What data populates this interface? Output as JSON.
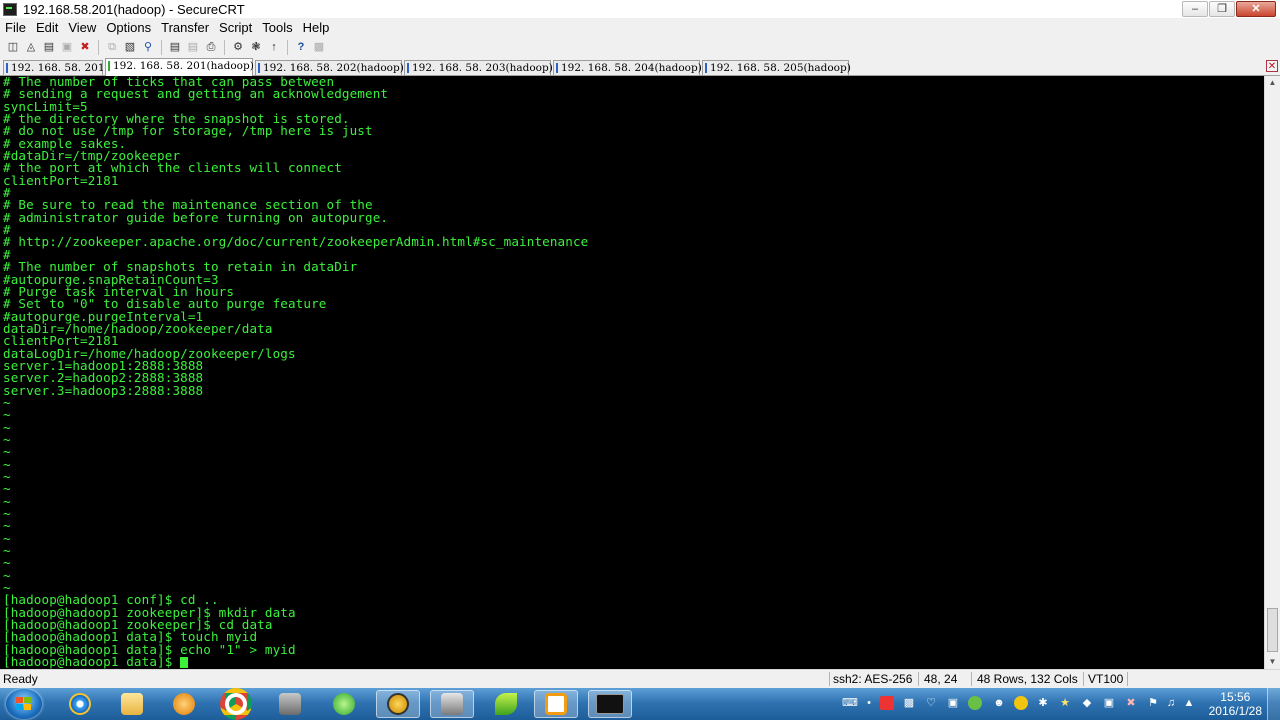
{
  "window": {
    "title": "192.168.58.201(hadoop) - SecureCRT"
  },
  "menu": [
    "File",
    "Edit",
    "View",
    "Options",
    "Transfer",
    "Script",
    "Tools",
    "Help"
  ],
  "toolbar": {
    "icons": [
      "connect-icon",
      "quick-connect-icon",
      "connect-in-tab-icon",
      "reconnect-icon",
      "disconnect-icon",
      "copy-icon",
      "paste-icon",
      "find-icon",
      "print-setup-icon",
      "print-selection-icon",
      "print-icon",
      "session-options-icon",
      "global-options-icon",
      "keymap-icon",
      "help-icon",
      "sftp-icon"
    ]
  },
  "tabs": [
    {
      "label": "192. 168. 58. 201",
      "active": false
    },
    {
      "label": "192. 168. 58. 201(hadoop)",
      "active": true
    },
    {
      "label": "192. 168. 58. 202(hadoop)",
      "active": false
    },
    {
      "label": "192. 168. 58. 203(hadoop)",
      "active": false
    },
    {
      "label": "192. 168. 58. 204(hadoop)",
      "active": false
    },
    {
      "label": "192. 168. 58. 205(hadoop)",
      "active": false
    }
  ],
  "terminal": {
    "lines": [
      "# The number of ticks that can pass between",
      "# sending a request and getting an acknowledgement",
      "syncLimit=5",
      "# the directory where the snapshot is stored.",
      "# do not use /tmp for storage, /tmp here is just",
      "# example sakes.",
      "#dataDir=/tmp/zookeeper",
      "# the port at which the clients will connect",
      "clientPort=2181",
      "#",
      "# Be sure to read the maintenance section of the",
      "# administrator guide before turning on autopurge.",
      "#",
      "# http://zookeeper.apache.org/doc/current/zookeeperAdmin.html#sc_maintenance",
      "#",
      "# The number of snapshots to retain in dataDir",
      "#autopurge.snapRetainCount=3",
      "# Purge task interval in hours",
      "# Set to \"0\" to disable auto purge feature",
      "#autopurge.purgeInterval=1",
      "dataDir=/home/hadoop/zookeeper/data",
      "clientPort=2181",
      "dataLogDir=/home/hadoop/zookeeper/logs",
      "server.1=hadoop1:2888:3888",
      "server.2=hadoop2:2888:3888",
      "server.3=hadoop3:2888:3888",
      "~",
      "~",
      "~",
      "~",
      "~",
      "~",
      "~",
      "~",
      "~",
      "~",
      "~",
      "~",
      "~",
      "~",
      "~",
      "~",
      "[hadoop@hadoop1 conf]$ cd ..",
      "[hadoop@hadoop1 zookeeper]$ mkdir data",
      "[hadoop@hadoop1 zookeeper]$ cd data",
      "[hadoop@hadoop1 data]$ touch myid",
      "[hadoop@hadoop1 data]$ echo \"1\" > myid",
      "[hadoop@hadoop1 data]$ "
    ],
    "text_color": "#3cf03c",
    "background": "#000000"
  },
  "status": {
    "ready": "Ready",
    "cipher": "ssh2: AES-256",
    "position": "48, 24",
    "size": "48 Rows, 132 Cols",
    "emulation": "VT100"
  },
  "taskbar": {
    "apps": [
      "ie-icon",
      "folder-icon",
      "media-player-icon",
      "chrome-icon",
      "briefcase-icon",
      "refresh-app-icon",
      "e-app-icon",
      "scanner-icon",
      "leaf-app-icon",
      "window-app-icon",
      "terminal-icon"
    ],
    "time": "15:56",
    "date": "2016/1/28"
  }
}
